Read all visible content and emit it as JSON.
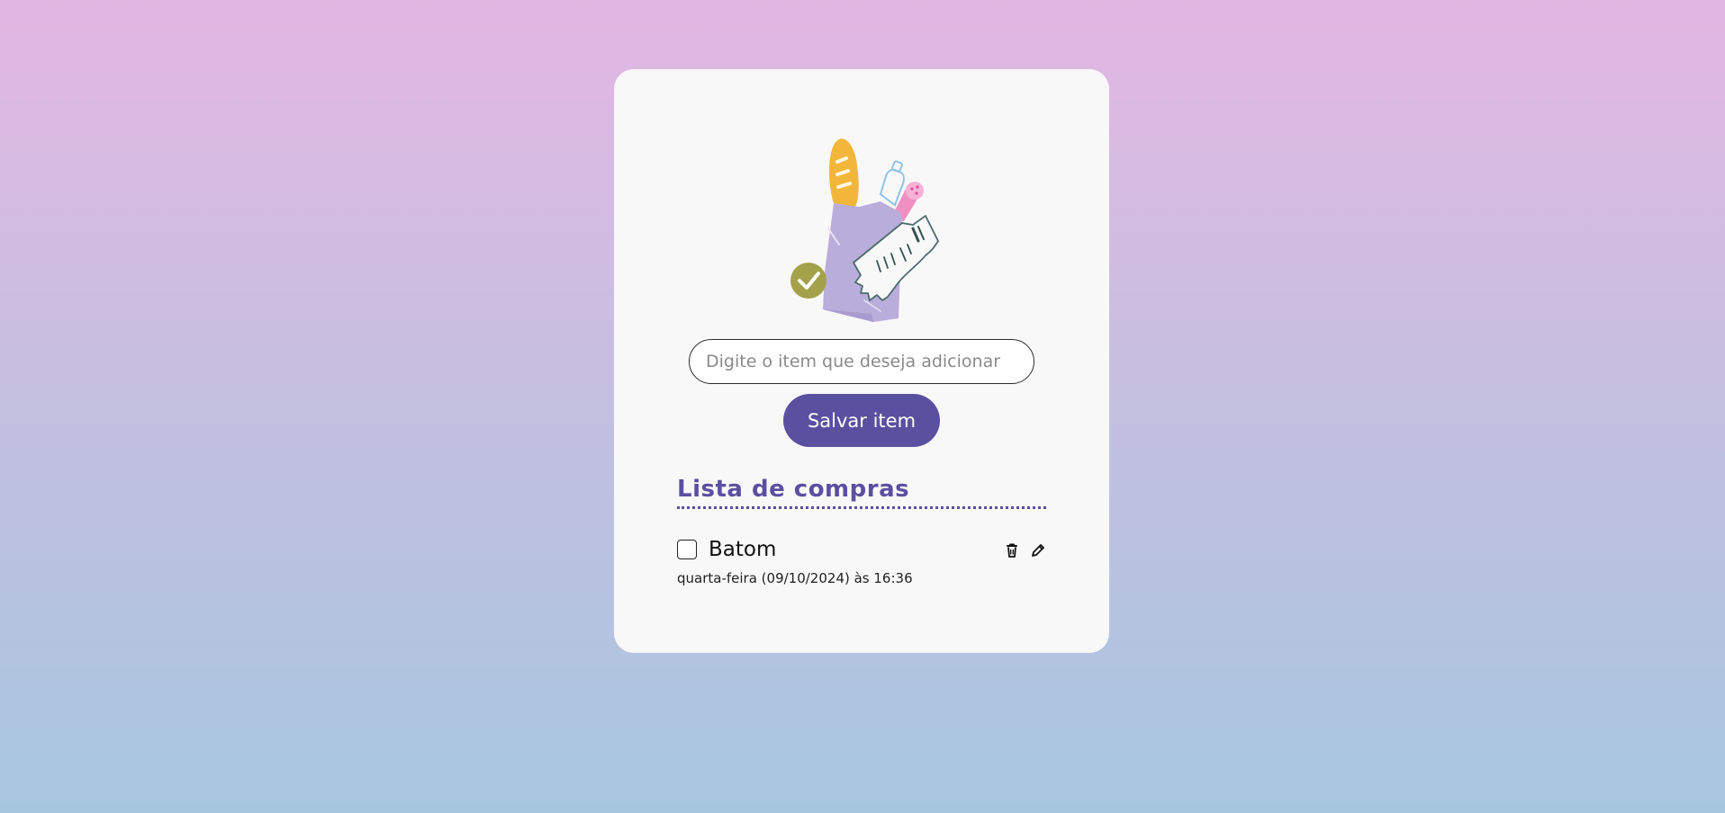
{
  "form": {
    "input_placeholder": "Digite o item que deseja adicionar",
    "input_value": "",
    "save_label": "Salvar item"
  },
  "list": {
    "title": "Lista de compras",
    "items": [
      {
        "name": "Batom",
        "checked": false,
        "date": "quarta-feira (09/10/2024) às 16:36",
        "icons": [
          "trash-icon",
          "pencil-icon"
        ]
      }
    ]
  },
  "illustration": {
    "name": "grocery-bag-illustration",
    "contents": [
      "bread-icon",
      "water-bottle-icon",
      "sausage-icon",
      "receipt-icon",
      "check-badge-icon"
    ]
  },
  "colors": {
    "accent": "#5b4fa0",
    "card_background": "#f9f8f8",
    "gradient_top": "#e3b6e2",
    "gradient_bottom": "#a6c6e0",
    "bag": "#b9addb",
    "bread": "#f2b73a",
    "sausage": "#ef8fc2",
    "check_badge": "#a3a24a"
  }
}
